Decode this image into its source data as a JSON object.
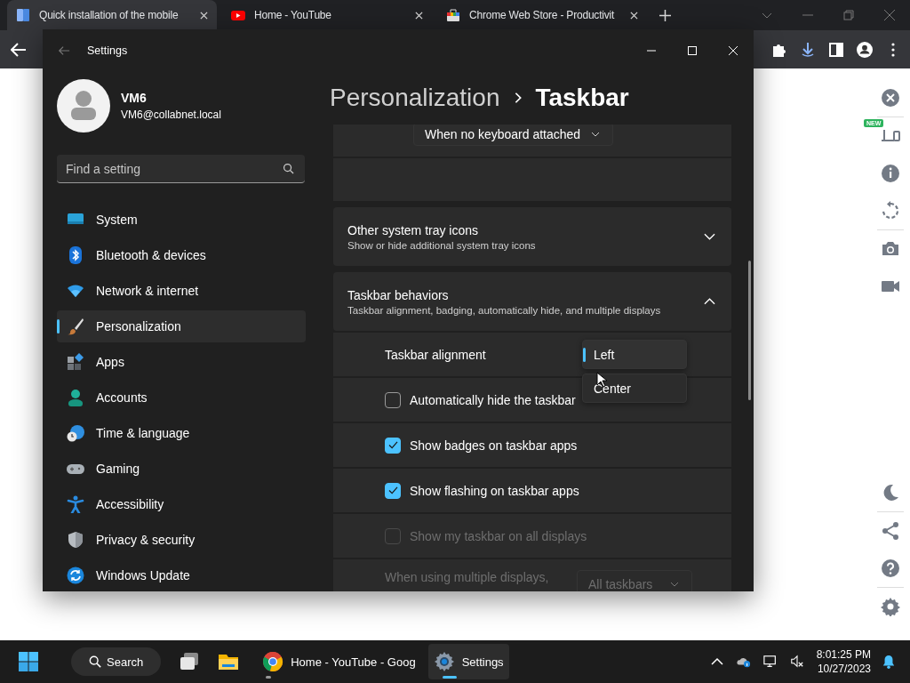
{
  "browser": {
    "tabs": [
      {
        "title": "Quick installation of the mobile",
        "selected": true
      },
      {
        "title": "Home - YouTube",
        "selected": false
      },
      {
        "title": "Chrome Web Store - Productivit",
        "selected": false
      }
    ],
    "sidebar": {
      "badge": "NEW"
    }
  },
  "settings": {
    "title": "Settings",
    "user": {
      "name": "VM6",
      "email": "VM6@collabnet.local"
    },
    "search": {
      "placeholder": "Find a setting"
    },
    "nav": [
      {
        "label": "System",
        "selected": false
      },
      {
        "label": "Bluetooth & devices",
        "selected": false
      },
      {
        "label": "Network & internet",
        "selected": false
      },
      {
        "label": "Personalization",
        "selected": true
      },
      {
        "label": "Apps",
        "selected": false
      },
      {
        "label": "Accounts",
        "selected": false
      },
      {
        "label": "Time & language",
        "selected": false
      },
      {
        "label": "Gaming",
        "selected": false
      },
      {
        "label": "Accessibility",
        "selected": false
      },
      {
        "label": "Privacy & security",
        "selected": false
      },
      {
        "label": "Windows Update",
        "selected": false
      }
    ],
    "breadcrumb": [
      "Personalization",
      "Taskbar"
    ],
    "sections": [
      {
        "kind": "dropdown-card",
        "value": "When no keyboard attached"
      },
      {
        "kind": "expander",
        "title": "Other system tray icons",
        "subtitle": "Show or hide additional system tray icons",
        "expanded": false
      },
      {
        "kind": "expander",
        "title": "Taskbar behaviors",
        "subtitle": "Taskbar alignment, badging, automatically hide, and multiple displays",
        "expanded": true,
        "rows": [
          {
            "kind": "select",
            "label": "Taskbar alignment",
            "options": [
              {
                "label": "Left",
                "selected": true
              },
              {
                "label": "Center",
                "selected": false
              }
            ]
          },
          {
            "kind": "checkbox",
            "label": "Automatically hide the taskbar",
            "checked": false,
            "disabled": false
          },
          {
            "kind": "checkbox",
            "label": "Show badges on taskbar apps",
            "checked": true,
            "disabled": false
          },
          {
            "kind": "checkbox",
            "label": "Show flashing on taskbar apps",
            "checked": true,
            "disabled": false
          },
          {
            "kind": "checkbox",
            "label": "Show my taskbar on all displays",
            "checked": false,
            "disabled": true
          },
          {
            "kind": "dropdown",
            "label": "When using multiple displays,",
            "value": "All taskbars",
            "disabled": true
          }
        ]
      }
    ]
  },
  "taskbar": {
    "search": "Search",
    "apps": [
      {
        "label": "Home - YouTube - Goog",
        "active": false
      },
      {
        "label": "Settings",
        "active": true
      }
    ],
    "clock": {
      "time": "8:01:25 PM",
      "date": "10/27/2023"
    }
  }
}
